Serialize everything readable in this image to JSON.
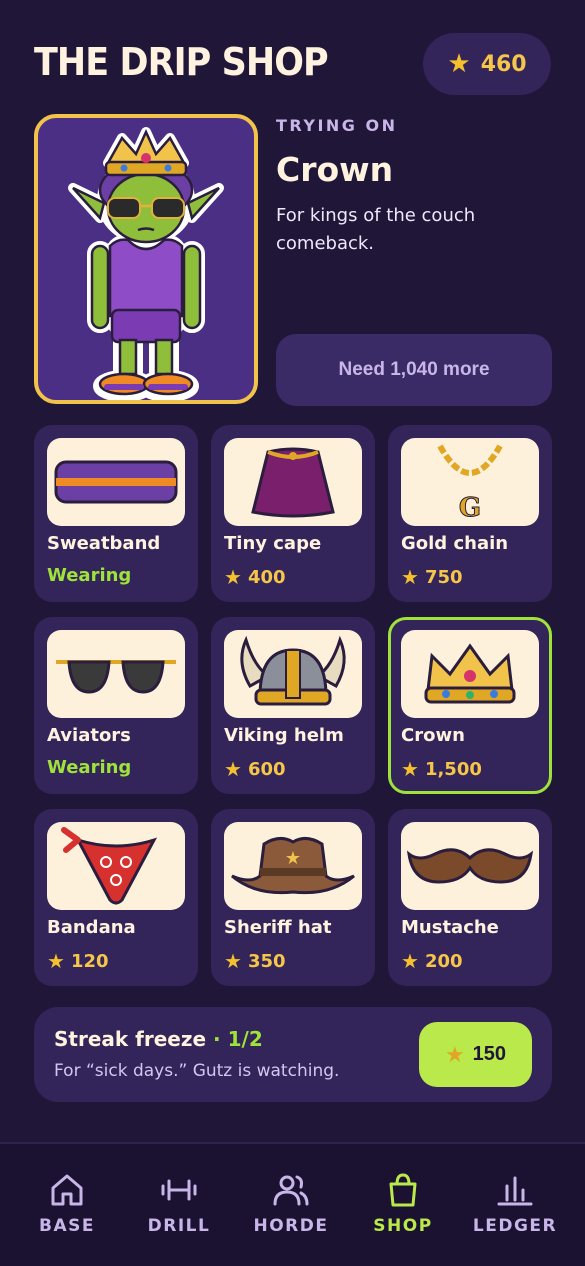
{
  "header": {
    "title": "THE DRIP SHOP",
    "balance": "460"
  },
  "preview": {
    "label": "TRYING ON",
    "item_name": "Crown",
    "description": "For kings of the couch comeback.",
    "need_label": "Need 1,040 more"
  },
  "items": [
    {
      "name": "Sweatband",
      "status": "Wearing",
      "price": null,
      "icon": "sweatband-icon"
    },
    {
      "name": "Tiny cape",
      "status": null,
      "price": "400",
      "icon": "cape-icon"
    },
    {
      "name": "Gold chain",
      "status": null,
      "price": "750",
      "icon": "gold-chain-icon"
    },
    {
      "name": "Aviators",
      "status": "Wearing",
      "price": null,
      "icon": "aviators-icon"
    },
    {
      "name": "Viking helm",
      "status": null,
      "price": "600",
      "icon": "viking-helm-icon"
    },
    {
      "name": "Crown",
      "status": null,
      "price": "1,500",
      "icon": "crown-icon",
      "selected": true
    },
    {
      "name": "Bandana",
      "status": null,
      "price": "120",
      "icon": "bandana-icon"
    },
    {
      "name": "Sheriff hat",
      "status": null,
      "price": "350",
      "icon": "sheriff-hat-icon"
    },
    {
      "name": "Mustache",
      "status": null,
      "price": "200",
      "icon": "mustache-icon"
    }
  ],
  "freeze": {
    "title": "Streak freeze",
    "count": "· 1/2",
    "subtitle": "For “sick days.” Gutz is watching.",
    "price": "150"
  },
  "nav": [
    {
      "label": "BASE",
      "icon": "home-icon"
    },
    {
      "label": "DRILL",
      "icon": "dumbbell-icon"
    },
    {
      "label": "HORDE",
      "icon": "users-icon"
    },
    {
      "label": "SHOP",
      "icon": "shopping-bag-icon",
      "active": true
    },
    {
      "label": "LEDGER",
      "icon": "bar-chart-icon"
    }
  ],
  "colors": {
    "background": "#1f1638",
    "card": "#33245a",
    "accent_green": "#9ee23a",
    "gold": "#f4c12c",
    "preview_border": "#f2c34a"
  }
}
